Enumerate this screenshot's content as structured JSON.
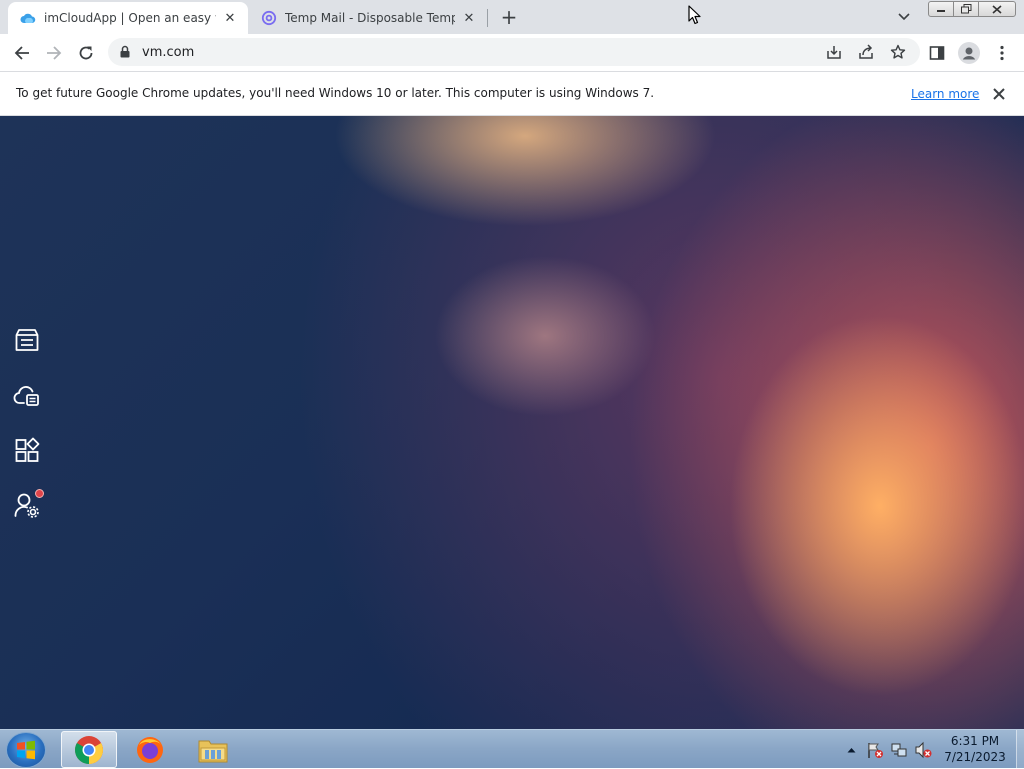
{
  "browser": {
    "tabs": [
      {
        "title": "imCloudApp | Open an easy work",
        "favicon": "cloud-icon",
        "active": true
      },
      {
        "title": "Temp Mail - Disposable Tempora",
        "favicon": "at-sign-icon",
        "active": false
      }
    ],
    "url": "vm.com",
    "infobar": {
      "message": "To get future Google Chrome updates, you'll need Windows 10 or later. This computer is using Windows 7.",
      "link": "Learn more"
    }
  },
  "sidebar": {
    "items": [
      {
        "icon": "storage-drawer-icon"
      },
      {
        "icon": "cloud-storage-icon"
      },
      {
        "icon": "apps-grid-icon"
      },
      {
        "icon": "user-settings-icon",
        "has_notification": true
      }
    ]
  },
  "taskbar": {
    "apps": [
      "chrome",
      "firefox",
      "file-explorer"
    ],
    "clock": {
      "time": "6:31 PM",
      "date": "7/21/2023"
    }
  }
}
